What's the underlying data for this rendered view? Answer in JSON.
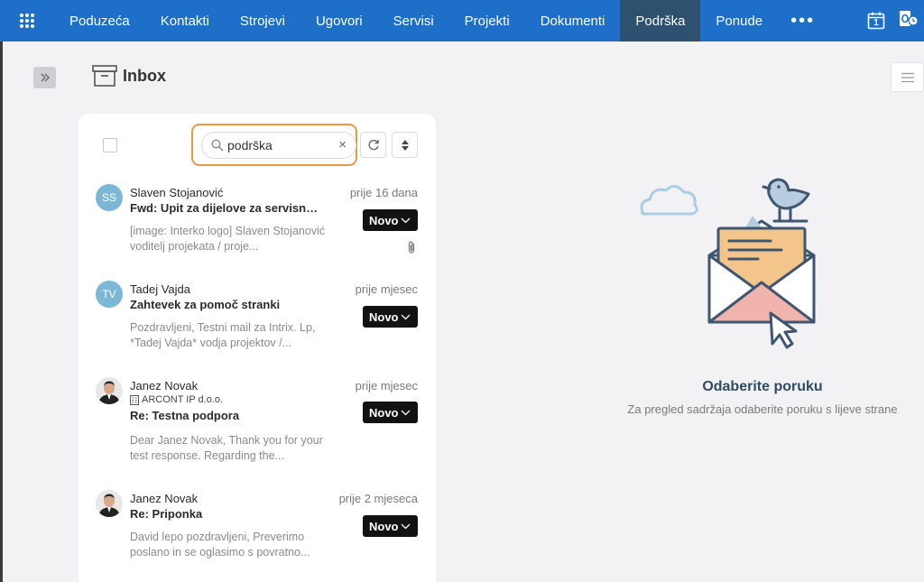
{
  "nav": {
    "items": [
      {
        "label": "Poduzeća",
        "active": false
      },
      {
        "label": "Kontakti",
        "active": false
      },
      {
        "label": "Strojevi",
        "active": false
      },
      {
        "label": "Ugovori",
        "active": false
      },
      {
        "label": "Servisi",
        "active": false
      },
      {
        "label": "Projekti",
        "active": false
      },
      {
        "label": "Dokumenti",
        "active": false
      },
      {
        "label": "Podrška",
        "active": true
      },
      {
        "label": "Ponude",
        "active": false
      }
    ],
    "more": "•••",
    "calendar_day": "1"
  },
  "page": {
    "title": "Inbox"
  },
  "search": {
    "value": "podrška",
    "clear": "×"
  },
  "messages": [
    {
      "initials": "SS",
      "sender": "Slaven Stojanović",
      "date": "prije 16 dana",
      "subject": "Fwd: Upit za dijelove za servisnu ra...",
      "snippet": "[image: Interko logo] Slaven Stojanović voditelj projekata / proje...",
      "status": "Novo",
      "attachment": true
    },
    {
      "initials": "TV",
      "sender": "Tadej Vajda",
      "date": "prije mjesec",
      "subject": "Zahtevek za pomoč stranki",
      "snippet": "Pozdravljeni, Testni mail za Intrix. Lp, *Tadej Vajda* vodja projektov /...",
      "status": "Novo"
    },
    {
      "sender": "Janez Novak",
      "company": "ARCONT IP d.o.o.",
      "date": "prije mjesec",
      "subject": "Re: Testna podpora",
      "snippet": "Dear Janez Novak, Thank you for your test response. Regarding the...",
      "status": "Novo"
    },
    {
      "sender": "Janez Novak",
      "date": "prije 2 mjeseca",
      "subject": "Re: Priponka",
      "snippet": "David lepo pozdravljeni, Preverimo poslano in se oglasimo s povratno...",
      "status": "Novo"
    }
  ],
  "empty_state": {
    "title": "Odaberite poruku",
    "subtitle": "Za pregled sadržaja odaberite poruku s lijeve strane"
  },
  "colors": {
    "nav_bg": "#1d6fc7",
    "nav_active": "#2e5170",
    "search_highlight": "#e59a41",
    "badge_bg": "#121212"
  }
}
